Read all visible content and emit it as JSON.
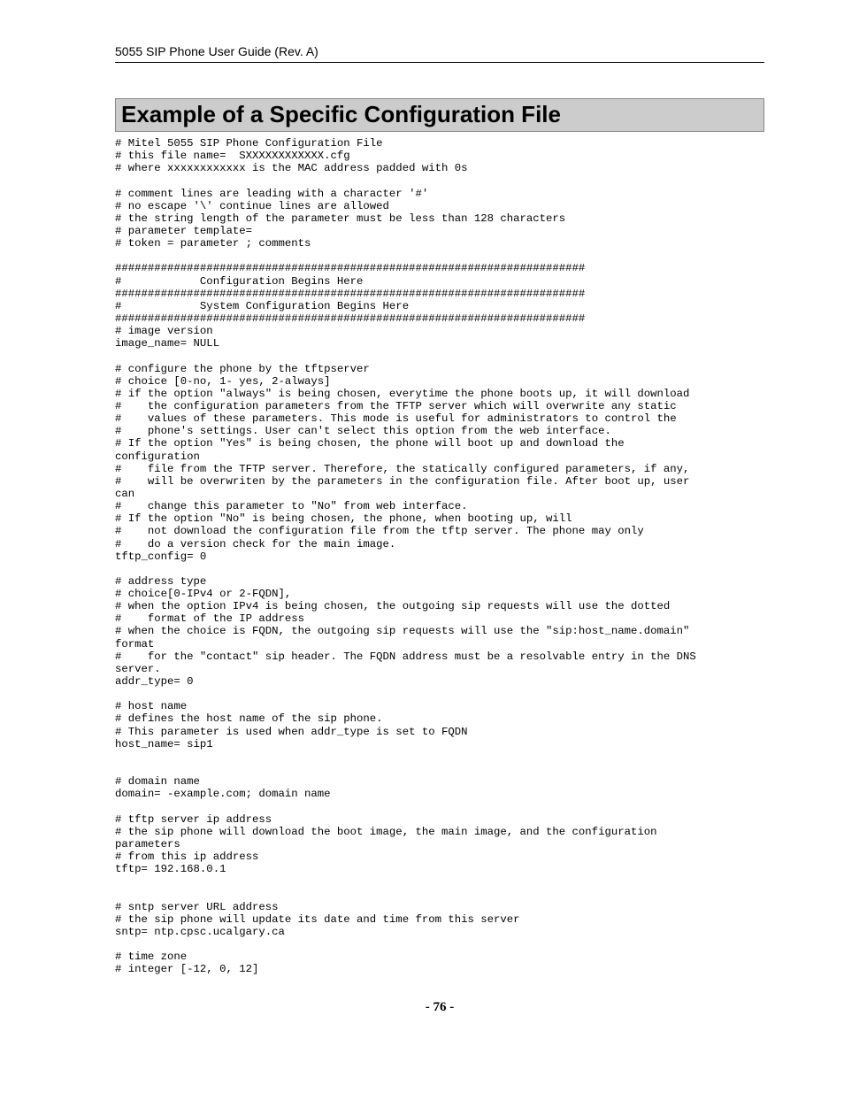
{
  "header": "5055 SIP Phone User Guide (Rev. A)",
  "title": "Example of a Specific Configuration File",
  "config_lines": [
    "# Mitel 5055 SIP Phone Configuration File",
    "# this file name=  SXXXXXXXXXXXX.cfg",
    "# where xxxxxxxxxxxx is the MAC address padded with 0s",
    "",
    "# comment lines are leading with a character '#'",
    "# no escape '\\' continue lines are allowed",
    "# the string length of the parameter must be less than 128 characters",
    "# parameter template=",
    "# token = parameter ; comments",
    "",
    "########################################################################",
    "#            Configuration Begins Here",
    "########################################################################",
    "#            System Configuration Begins Here",
    "########################################################################",
    "# image version",
    "image_name= NULL",
    "",
    "# configure the phone by the tftpserver",
    "# choice [0-no, 1- yes, 2-always]",
    "# if the option \"always\" is being chosen, everytime the phone boots up, it will download",
    "#    the configuration parameters from the TFTP server which will overwrite any static",
    "#    values of these parameters. This mode is useful for administrators to control the",
    "#    phone's settings. User can't select this option from the web interface.",
    "# If the option \"Yes\" is being chosen, the phone will boot up and download the",
    "configuration",
    "#    file from the TFTP server. Therefore, the statically configured parameters, if any,",
    "#    will be overwriten by the parameters in the configuration file. After boot up, user",
    "can",
    "#    change this parameter to \"No\" from web interface.",
    "# If the option \"No\" is being chosen, the phone, when booting up, will",
    "#    not download the configuration file from the tftp server. The phone may only",
    "#    do a version check for the main image.",
    "tftp_config= 0",
    "",
    "# address type",
    "# choice[0-IPv4 or 2-FQDN],",
    "# when the option IPv4 is being chosen, the outgoing sip requests will use the dotted",
    "#    format of the IP address",
    "# when the choice is FQDN, the outgoing sip requests will use the \"sip:host_name.domain\"",
    "format",
    "#    for the \"contact\" sip header. The FQDN address must be a resolvable entry in the DNS",
    "server.",
    "addr_type= 0",
    "",
    "# host name",
    "# defines the host name of the sip phone.",
    "# This parameter is used when addr_type is set to FQDN",
    "host_name= sip1",
    "",
    "",
    "# domain name",
    "domain= -example.com; domain name",
    "",
    "# tftp server ip address",
    "# the sip phone will download the boot image, the main image, and the configuration",
    "parameters",
    "# from this ip address",
    "tftp= 192.168.0.1",
    "",
    "",
    "# sntp server URL address",
    "# the sip phone will update its date and time from this server",
    "sntp= ntp.cpsc.ucalgary.ca",
    "",
    "# time zone",
    "# integer [-12, 0, 12]"
  ],
  "page_number": "- 76 -"
}
